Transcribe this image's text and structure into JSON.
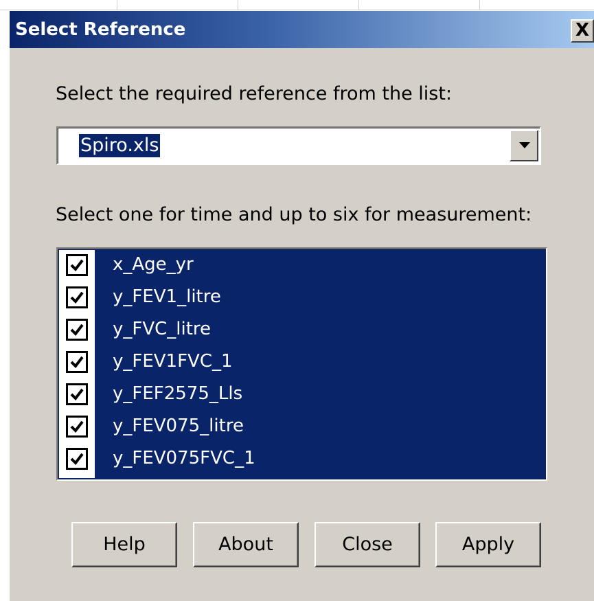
{
  "window": {
    "title": "Select Reference",
    "close_glyph": "X"
  },
  "reference": {
    "prompt": "Select the required reference from the list:",
    "selected_value": "Spiro.xls"
  },
  "measurements": {
    "prompt": "Select one for time and up to six for measurement:",
    "items": [
      {
        "label": "x_Age_yr",
        "checked": true
      },
      {
        "label": "y_FEV1_litre",
        "checked": true
      },
      {
        "label": "y_FVC_litre",
        "checked": true
      },
      {
        "label": "y_FEV1FVC_1",
        "checked": true
      },
      {
        "label": "y_FEF2575_Lls",
        "checked": true
      },
      {
        "label": "y_FEV075_litre",
        "checked": true
      },
      {
        "label": "y_FEV075FVC_1",
        "checked": true
      }
    ]
  },
  "buttons": {
    "help": "Help",
    "about": "About",
    "close": "Close",
    "apply": "Apply"
  },
  "colors": {
    "title_gradient_start": "#0a246a",
    "title_gradient_end": "#a6caf0",
    "dialog_face": "#d4d0c8",
    "selection": "#0a246a"
  },
  "icons": {
    "close": "close-icon",
    "dropdown": "chevron-down-icon",
    "check": "checkmark-icon"
  }
}
